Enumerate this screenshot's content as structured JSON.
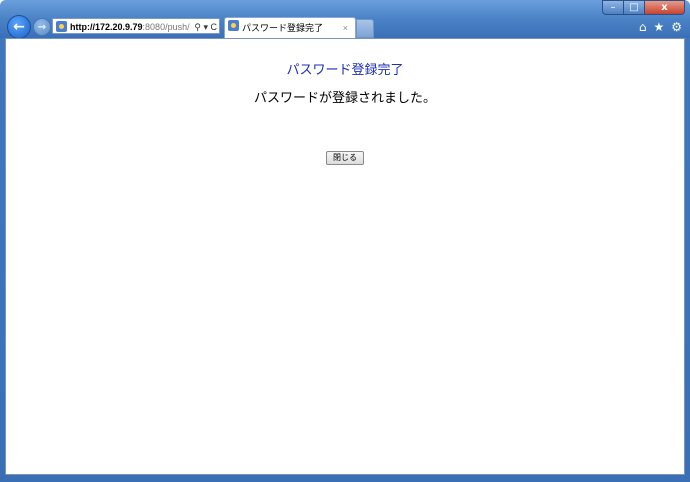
{
  "browser": {
    "url_host": "http://172.20.9.79",
    "url_rest": ":8080/push/",
    "address_icons": "⚲ ▾ C",
    "tab_title": "パスワード登録完了",
    "tab_close": "×",
    "window_controls": {
      "minimize": "–",
      "maximize": "□",
      "close": "x"
    },
    "toolbar_icons": [
      "home-icon",
      "star-icon",
      "gear-icon"
    ]
  },
  "page": {
    "heading": "パスワード登録完了",
    "message": "パスワードが登録されました。",
    "close_button_label": "閉じる"
  },
  "colors": {
    "heading": "#1e2fb0",
    "frame": "#3a6fb6"
  }
}
